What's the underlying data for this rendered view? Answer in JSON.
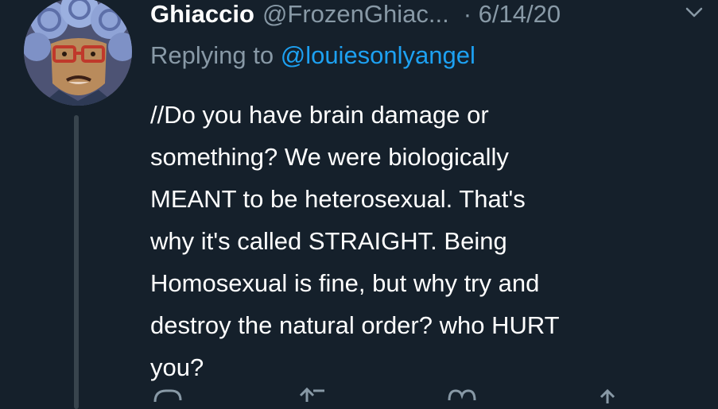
{
  "tweet": {
    "author_name": "Ghiaccio",
    "author_handle": "@FrozenGhiac...",
    "separator_date": "· 6/14/20",
    "reply_prefix": "Replying to",
    "reply_handle": "@louiesonlyangel",
    "text": "//Do you have brain damage or\nsomething? We were biologically\nMEANT to be heterosexual. That's\nwhy it's called STRAIGHT. Being\nHomosexual is fine, but why try and\ndestroy the natural order? who HURT\nyou?"
  },
  "icons": {
    "more": "chevron-down-icon",
    "reply": "reply-icon",
    "retweet": "retweet-icon",
    "like": "heart-icon",
    "share": "share-icon"
  },
  "colors": {
    "background": "#15202b",
    "secondary_text": "#8899a6",
    "link": "#1da1f2",
    "thread_line": "#38444d"
  }
}
